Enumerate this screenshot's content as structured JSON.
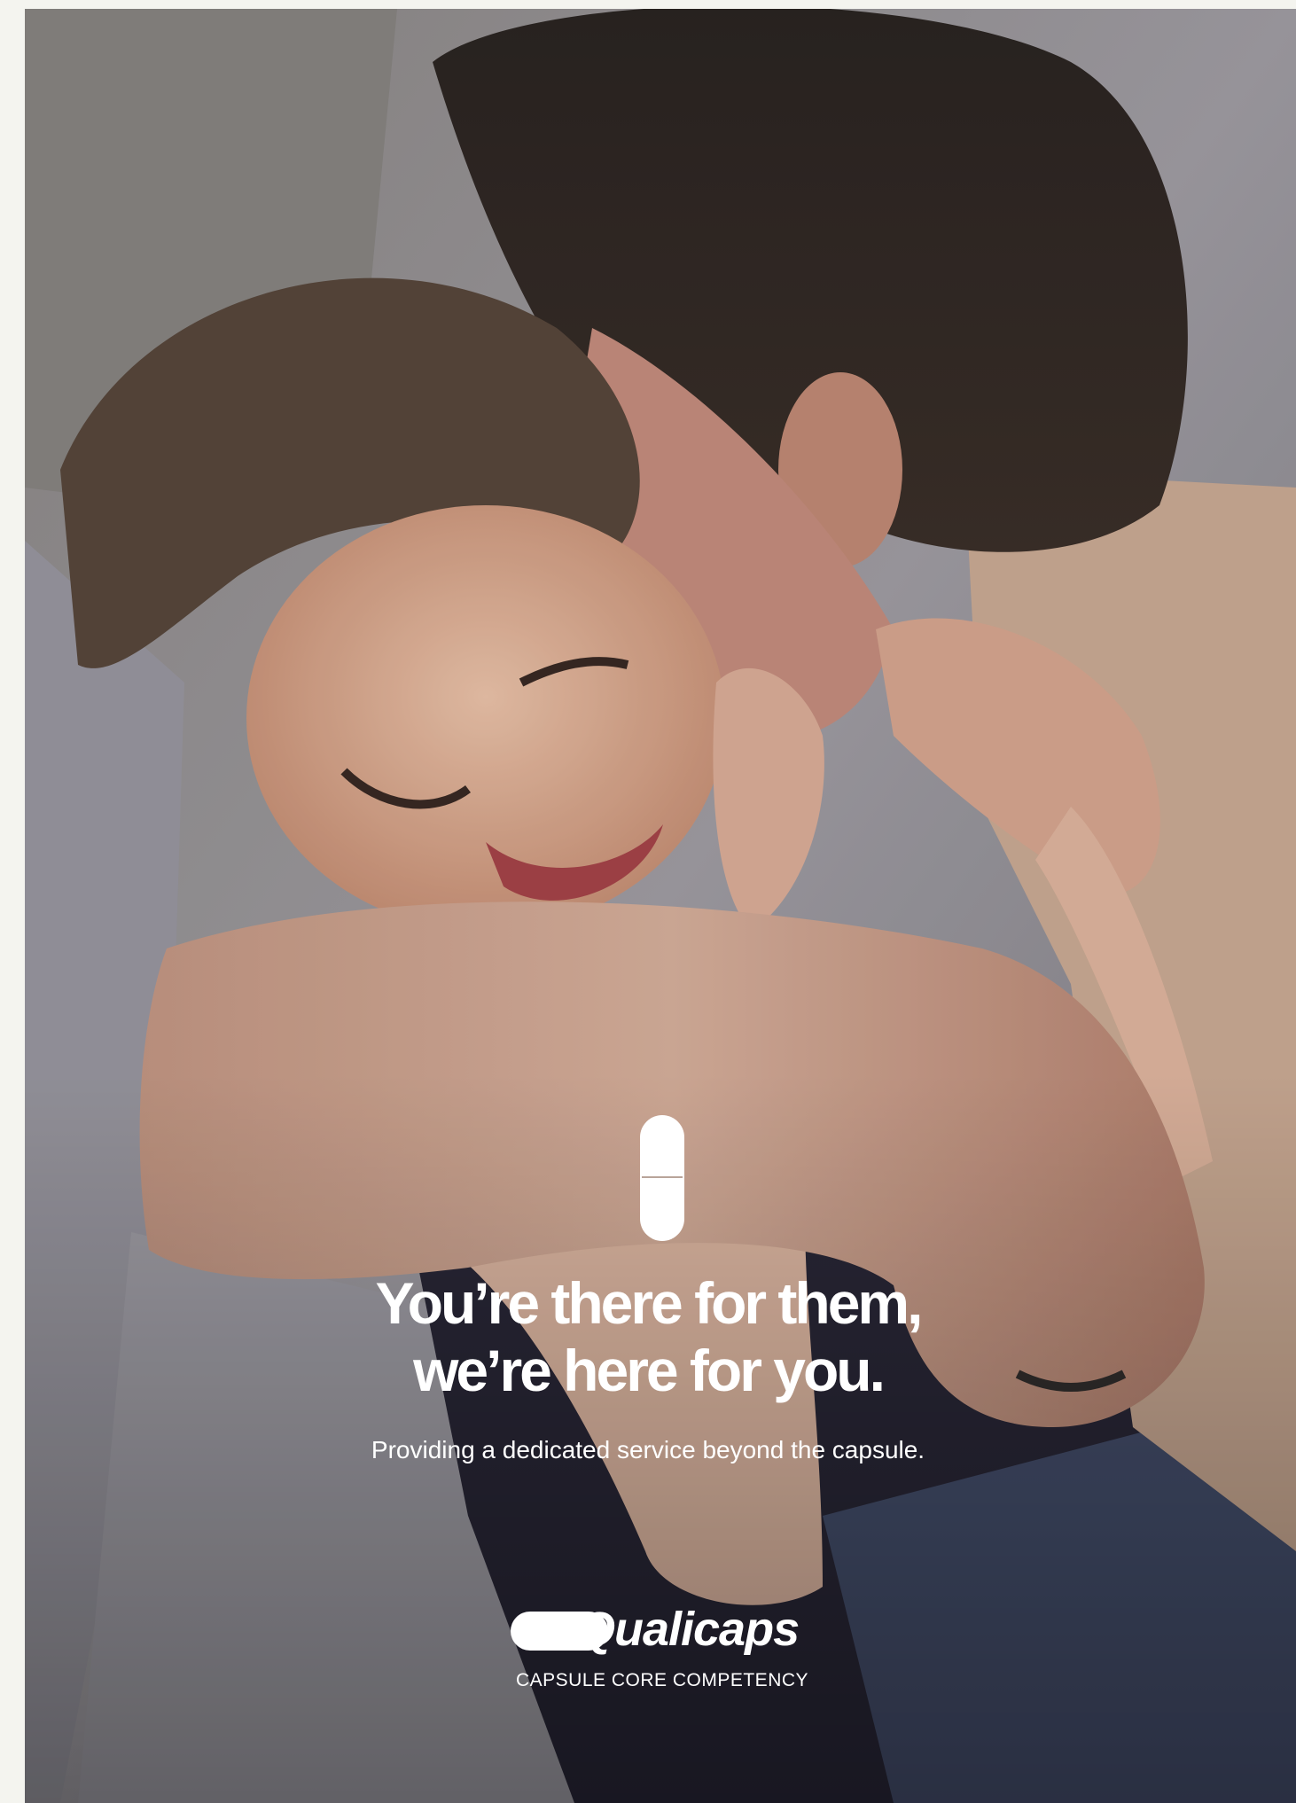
{
  "ad": {
    "headline_line1": "You’re there for them,",
    "headline_line2": "we’re here for you.",
    "subline": "Providing a dedicated service beyond the capsule.",
    "brand": "Qualicaps",
    "tagline": "CAPSULE CORE COMPETENCY"
  },
  "icons": {
    "capsule": "capsule-icon",
    "logo_pill": "capsule-logo-icon"
  },
  "colors": {
    "text": "#ffffff",
    "page_margin": "#f4f4ef"
  }
}
